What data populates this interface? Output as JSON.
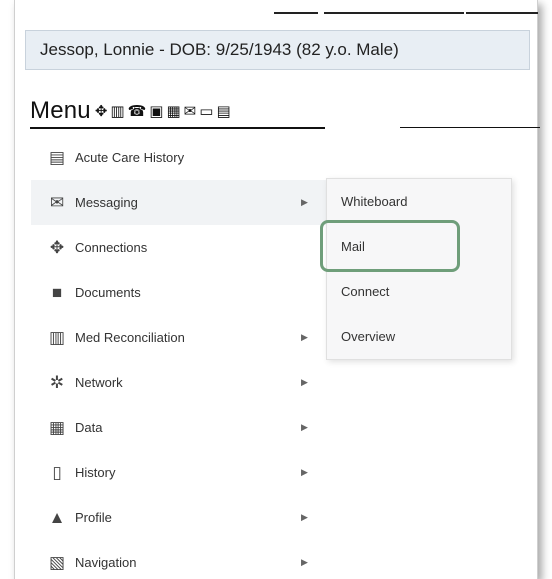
{
  "patient": {
    "banner": "Jessop, Lonnie - DOB: 9/25/1943 (82 y.o. Male)"
  },
  "menu": {
    "title": "Menu",
    "toolbar_icons": [
      {
        "name": "connections-icon",
        "glyph": "✥"
      },
      {
        "name": "med-reconciliation-icon",
        "glyph": "▥"
      },
      {
        "name": "phone-icon",
        "glyph": "☎"
      },
      {
        "name": "documents-icon",
        "glyph": "▣"
      },
      {
        "name": "calendar-icon",
        "glyph": "▦"
      },
      {
        "name": "mail-icon",
        "glyph": "✉"
      },
      {
        "name": "whiteboard-icon",
        "glyph": "▭"
      },
      {
        "name": "history-icon",
        "glyph": "▤"
      }
    ],
    "items": [
      {
        "label": "Acute Care History",
        "icon": "clipboard-icon",
        "glyph": "▤",
        "has_submenu": false
      },
      {
        "label": "Messaging",
        "icon": "envelope-icon",
        "glyph": "✉",
        "has_submenu": true
      },
      {
        "label": "Connections",
        "icon": "handshake-icon",
        "glyph": "✥",
        "has_submenu": false
      },
      {
        "label": "Documents",
        "icon": "folder-icon",
        "glyph": "■",
        "has_submenu": false
      },
      {
        "label": "Med Reconciliation",
        "icon": "med-reconciliation-icon",
        "glyph": "▥",
        "has_submenu": true
      },
      {
        "label": "Network",
        "icon": "network-icon",
        "glyph": "✲",
        "has_submenu": true
      },
      {
        "label": "Data",
        "icon": "data-icon",
        "glyph": "▦",
        "has_submenu": true
      },
      {
        "label": "History",
        "icon": "book-icon",
        "glyph": "▯",
        "has_submenu": true
      },
      {
        "label": "Profile",
        "icon": "user-icon",
        "glyph": "▲",
        "has_submenu": true
      },
      {
        "label": "Navigation",
        "icon": "navigation-icon",
        "glyph": "▧",
        "has_submenu": true
      }
    ],
    "arrow_glyph": "▶"
  },
  "submenu": {
    "items": [
      {
        "label": "Whiteboard"
      },
      {
        "label": "Mail"
      },
      {
        "label": "Connect"
      },
      {
        "label": "Overview"
      }
    ]
  },
  "colors": {
    "highlight": "#6f9e7a",
    "active_row": "#f1f3f5",
    "banner_bg": "#e8eef4"
  }
}
